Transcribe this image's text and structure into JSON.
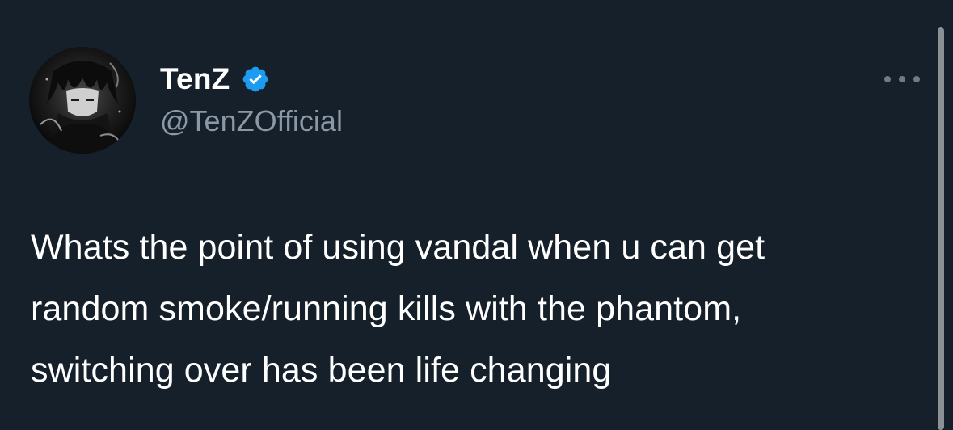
{
  "tweet": {
    "author": {
      "display_name": "TenZ",
      "handle": "@TenZOfficial",
      "verified": true
    },
    "text": "Whats the point of using vandal when u can get\nrandom smoke/running kills with the phantom,\nswitching over has been life changing",
    "more_icon": "more-horizontal-icon"
  },
  "colors": {
    "background": "#15202b",
    "text_primary": "#ffffff",
    "text_secondary": "#8b98a5",
    "verified_badge": "#1d9bf0"
  }
}
